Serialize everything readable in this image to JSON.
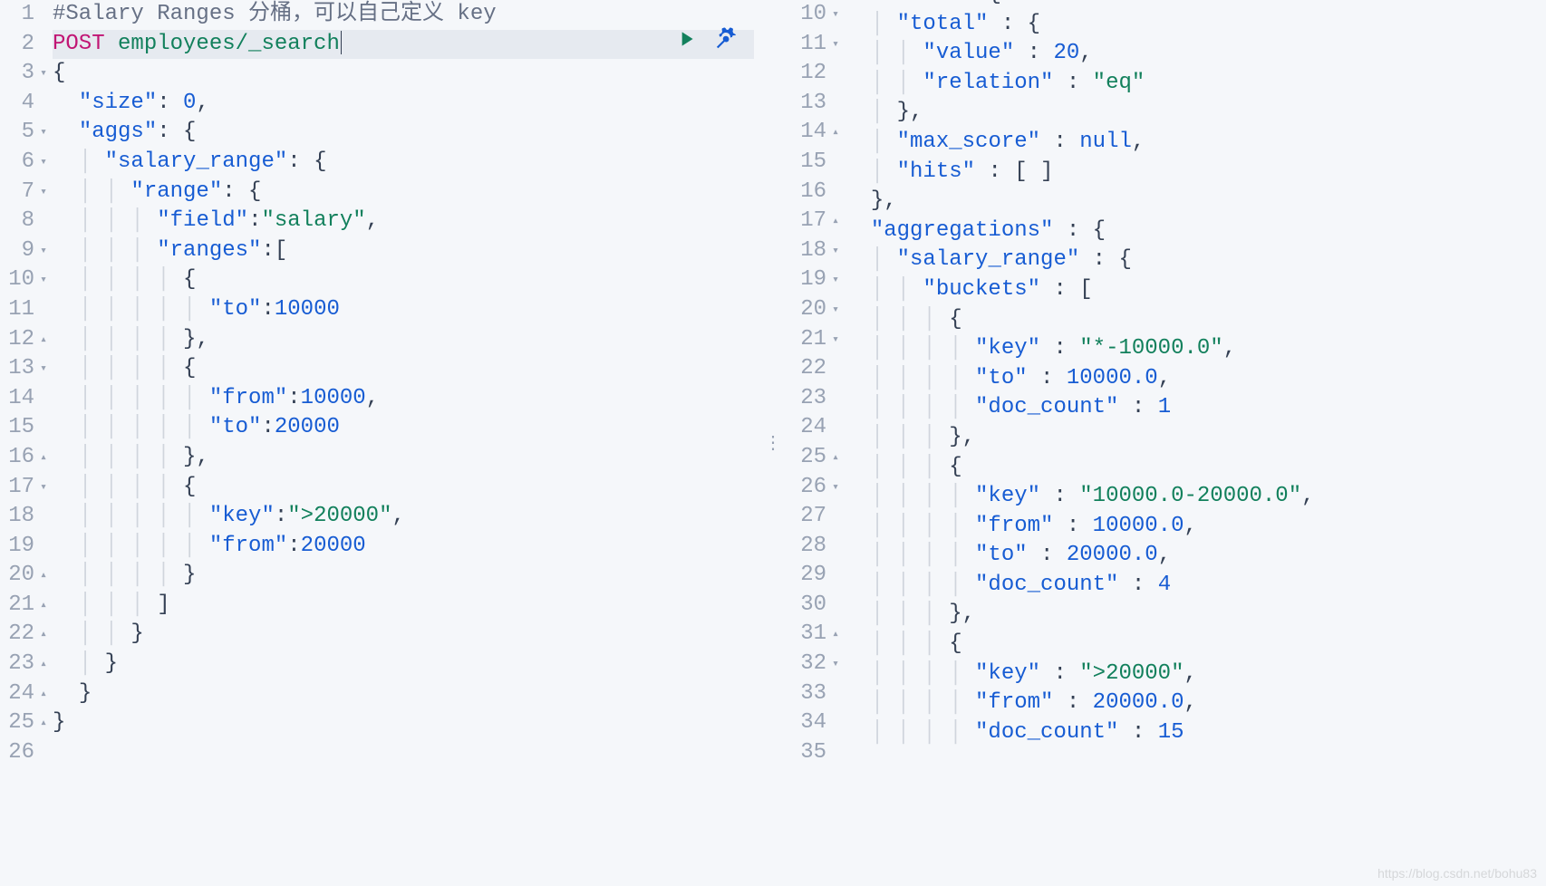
{
  "watermark": "https://blog.csdn.net/bohu83",
  "left": {
    "lines": [
      {
        "n": 1,
        "fold": "",
        "tokens": [
          [
            "comment",
            "#Salary Ranges 分桶，可以自己定义 key"
          ]
        ]
      },
      {
        "n": 2,
        "fold": "",
        "active": true,
        "tokens": [
          [
            "method",
            "POST"
          ],
          [
            "punc",
            " "
          ],
          [
            "path",
            "employees/_search"
          ]
        ],
        "cursor": true,
        "runIcons": true
      },
      {
        "n": 3,
        "fold": "▾",
        "tokens": [
          [
            "punc",
            "{"
          ]
        ]
      },
      {
        "n": 4,
        "fold": "",
        "tokens": [
          [
            "punc",
            "  "
          ],
          [
            "key",
            "\"size\""
          ],
          [
            "punc",
            ": "
          ],
          [
            "num",
            "0"
          ],
          [
            "punc",
            ","
          ]
        ]
      },
      {
        "n": 5,
        "fold": "▾",
        "tokens": [
          [
            "punc",
            "  "
          ],
          [
            "key",
            "\"aggs\""
          ],
          [
            "punc",
            ": {"
          ]
        ]
      },
      {
        "n": 6,
        "fold": "▾",
        "tokens": [
          [
            "punc",
            "  "
          ],
          [
            "guide",
            "| "
          ],
          [
            "key",
            "\"salary_range\""
          ],
          [
            "punc",
            ": {"
          ]
        ]
      },
      {
        "n": 7,
        "fold": "▾",
        "tokens": [
          [
            "punc",
            "  "
          ],
          [
            "guide",
            "| | "
          ],
          [
            "key",
            "\"range\""
          ],
          [
            "punc",
            ": {"
          ]
        ]
      },
      {
        "n": 8,
        "fold": "",
        "tokens": [
          [
            "punc",
            "  "
          ],
          [
            "guide",
            "| | | "
          ],
          [
            "key",
            "\"field\""
          ],
          [
            "punc",
            ":"
          ],
          [
            "str",
            "\"salary\""
          ],
          [
            "punc",
            ","
          ]
        ]
      },
      {
        "n": 9,
        "fold": "▾",
        "tokens": [
          [
            "punc",
            "  "
          ],
          [
            "guide",
            "| | | "
          ],
          [
            "key",
            "\"ranges\""
          ],
          [
            "punc",
            ":["
          ]
        ]
      },
      {
        "n": 10,
        "fold": "▾",
        "tokens": [
          [
            "punc",
            "  "
          ],
          [
            "guide",
            "| | | | "
          ],
          [
            "punc",
            "{"
          ]
        ]
      },
      {
        "n": 11,
        "fold": "",
        "tokens": [
          [
            "punc",
            "  "
          ],
          [
            "guide",
            "| | | | | "
          ],
          [
            "key",
            "\"to\""
          ],
          [
            "punc",
            ":"
          ],
          [
            "num",
            "10000"
          ]
        ]
      },
      {
        "n": 12,
        "fold": "▴",
        "tokens": [
          [
            "punc",
            "  "
          ],
          [
            "guide",
            "| | | | "
          ],
          [
            "punc",
            "},"
          ]
        ]
      },
      {
        "n": 13,
        "fold": "▾",
        "tokens": [
          [
            "punc",
            "  "
          ],
          [
            "guide",
            "| | | | "
          ],
          [
            "punc",
            "{"
          ]
        ]
      },
      {
        "n": 14,
        "fold": "",
        "tokens": [
          [
            "punc",
            "  "
          ],
          [
            "guide",
            "| | | | | "
          ],
          [
            "key",
            "\"from\""
          ],
          [
            "punc",
            ":"
          ],
          [
            "num",
            "10000"
          ],
          [
            "punc",
            ","
          ]
        ]
      },
      {
        "n": 15,
        "fold": "",
        "tokens": [
          [
            "punc",
            "  "
          ],
          [
            "guide",
            "| | | | | "
          ],
          [
            "key",
            "\"to\""
          ],
          [
            "punc",
            ":"
          ],
          [
            "num",
            "20000"
          ]
        ]
      },
      {
        "n": 16,
        "fold": "▴",
        "tokens": [
          [
            "punc",
            "  "
          ],
          [
            "guide",
            "| | | | "
          ],
          [
            "punc",
            "},"
          ]
        ]
      },
      {
        "n": 17,
        "fold": "▾",
        "tokens": [
          [
            "punc",
            "  "
          ],
          [
            "guide",
            "| | | | "
          ],
          [
            "punc",
            "{"
          ]
        ]
      },
      {
        "n": 18,
        "fold": "",
        "tokens": [
          [
            "punc",
            "  "
          ],
          [
            "guide",
            "| | | | | "
          ],
          [
            "key",
            "\"key\""
          ],
          [
            "punc",
            ":"
          ],
          [
            "str",
            "\">20000\""
          ],
          [
            "punc",
            ","
          ]
        ]
      },
      {
        "n": 19,
        "fold": "",
        "tokens": [
          [
            "punc",
            "  "
          ],
          [
            "guide",
            "| | | | | "
          ],
          [
            "key",
            "\"from\""
          ],
          [
            "punc",
            ":"
          ],
          [
            "num",
            "20000"
          ]
        ]
      },
      {
        "n": 20,
        "fold": "▴",
        "tokens": [
          [
            "punc",
            "  "
          ],
          [
            "guide",
            "| | | | "
          ],
          [
            "punc",
            "}"
          ]
        ]
      },
      {
        "n": 21,
        "fold": "▴",
        "tokens": [
          [
            "punc",
            "  "
          ],
          [
            "guide",
            "| | | "
          ],
          [
            "punc",
            "]"
          ]
        ]
      },
      {
        "n": 22,
        "fold": "▴",
        "tokens": [
          [
            "punc",
            "  "
          ],
          [
            "guide",
            "| | "
          ],
          [
            "punc",
            "}"
          ]
        ]
      },
      {
        "n": 23,
        "fold": "▴",
        "tokens": [
          [
            "punc",
            "  "
          ],
          [
            "guide",
            "| "
          ],
          [
            "punc",
            "}"
          ]
        ]
      },
      {
        "n": 24,
        "fold": "▴",
        "tokens": [
          [
            "punc",
            "  "
          ],
          [
            "punc",
            "}"
          ]
        ]
      },
      {
        "n": 25,
        "fold": "▴",
        "tokens": [
          [
            "punc",
            "}"
          ]
        ]
      },
      {
        "n": 26,
        "fold": "",
        "tokens": []
      }
    ]
  },
  "right": {
    "lines": [
      {
        "n": 10,
        "fold": "▾",
        "tokens": [
          [
            "punc",
            "  "
          ],
          [
            "key",
            "\"hits\""
          ],
          [
            "punc",
            " : {"
          ]
        ],
        "partial": true
      },
      {
        "n": 11,
        "fold": "▾",
        "tokens": [
          [
            "punc",
            "  "
          ],
          [
            "guide",
            "| "
          ],
          [
            "key",
            "\"total\""
          ],
          [
            "punc",
            " : {"
          ]
        ]
      },
      {
        "n": 12,
        "fold": "",
        "tokens": [
          [
            "punc",
            "  "
          ],
          [
            "guide",
            "| | "
          ],
          [
            "key",
            "\"value\""
          ],
          [
            "punc",
            " : "
          ],
          [
            "num",
            "20"
          ],
          [
            "punc",
            ","
          ]
        ]
      },
      {
        "n": 13,
        "fold": "",
        "tokens": [
          [
            "punc",
            "  "
          ],
          [
            "guide",
            "| | "
          ],
          [
            "key",
            "\"relation\""
          ],
          [
            "punc",
            " : "
          ],
          [
            "str",
            "\"eq\""
          ]
        ]
      },
      {
        "n": 14,
        "fold": "▴",
        "tokens": [
          [
            "punc",
            "  "
          ],
          [
            "guide",
            "| "
          ],
          [
            "punc",
            "},"
          ]
        ]
      },
      {
        "n": 15,
        "fold": "",
        "tokens": [
          [
            "punc",
            "  "
          ],
          [
            "guide",
            "| "
          ],
          [
            "key",
            "\"max_score\""
          ],
          [
            "punc",
            " : "
          ],
          [
            "null",
            "null"
          ],
          [
            "punc",
            ","
          ]
        ]
      },
      {
        "n": 16,
        "fold": "",
        "tokens": [
          [
            "punc",
            "  "
          ],
          [
            "guide",
            "| "
          ],
          [
            "key",
            "\"hits\""
          ],
          [
            "punc",
            " : [ ]"
          ]
        ]
      },
      {
        "n": 17,
        "fold": "▴",
        "tokens": [
          [
            "punc",
            "  "
          ],
          [
            "punc",
            "},"
          ]
        ]
      },
      {
        "n": 18,
        "fold": "▾",
        "tokens": [
          [
            "punc",
            "  "
          ],
          [
            "key",
            "\"aggregations\""
          ],
          [
            "punc",
            " : {"
          ]
        ]
      },
      {
        "n": 19,
        "fold": "▾",
        "tokens": [
          [
            "punc",
            "  "
          ],
          [
            "guide",
            "| "
          ],
          [
            "key",
            "\"salary_range\""
          ],
          [
            "punc",
            " : {"
          ]
        ]
      },
      {
        "n": 20,
        "fold": "▾",
        "tokens": [
          [
            "punc",
            "  "
          ],
          [
            "guide",
            "| | "
          ],
          [
            "key",
            "\"buckets\""
          ],
          [
            "punc",
            " : ["
          ]
        ]
      },
      {
        "n": 21,
        "fold": "▾",
        "tokens": [
          [
            "punc",
            "  "
          ],
          [
            "guide",
            "| | | "
          ],
          [
            "punc",
            "{"
          ]
        ]
      },
      {
        "n": 22,
        "fold": "",
        "tokens": [
          [
            "punc",
            "  "
          ],
          [
            "guide",
            "| | | | "
          ],
          [
            "key",
            "\"key\""
          ],
          [
            "punc",
            " : "
          ],
          [
            "str",
            "\"*-10000.0\""
          ],
          [
            "punc",
            ","
          ]
        ]
      },
      {
        "n": 23,
        "fold": "",
        "tokens": [
          [
            "punc",
            "  "
          ],
          [
            "guide",
            "| | | | "
          ],
          [
            "key",
            "\"to\""
          ],
          [
            "punc",
            " : "
          ],
          [
            "num",
            "10000.0"
          ],
          [
            "punc",
            ","
          ]
        ]
      },
      {
        "n": 24,
        "fold": "",
        "tokens": [
          [
            "punc",
            "  "
          ],
          [
            "guide",
            "| | | | "
          ],
          [
            "key",
            "\"doc_count\""
          ],
          [
            "punc",
            " : "
          ],
          [
            "num",
            "1"
          ]
        ]
      },
      {
        "n": 25,
        "fold": "▴",
        "tokens": [
          [
            "punc",
            "  "
          ],
          [
            "guide",
            "| | | "
          ],
          [
            "punc",
            "},"
          ]
        ]
      },
      {
        "n": 26,
        "fold": "▾",
        "tokens": [
          [
            "punc",
            "  "
          ],
          [
            "guide",
            "| | | "
          ],
          [
            "punc",
            "{"
          ]
        ]
      },
      {
        "n": 27,
        "fold": "",
        "tokens": [
          [
            "punc",
            "  "
          ],
          [
            "guide",
            "| | | | "
          ],
          [
            "key",
            "\"key\""
          ],
          [
            "punc",
            " : "
          ],
          [
            "str",
            "\"10000.0-20000.0\""
          ],
          [
            "punc",
            ","
          ]
        ]
      },
      {
        "n": 28,
        "fold": "",
        "tokens": [
          [
            "punc",
            "  "
          ],
          [
            "guide",
            "| | | | "
          ],
          [
            "key",
            "\"from\""
          ],
          [
            "punc",
            " : "
          ],
          [
            "num",
            "10000.0"
          ],
          [
            "punc",
            ","
          ]
        ]
      },
      {
        "n": 29,
        "fold": "",
        "tokens": [
          [
            "punc",
            "  "
          ],
          [
            "guide",
            "| | | | "
          ],
          [
            "key",
            "\"to\""
          ],
          [
            "punc",
            " : "
          ],
          [
            "num",
            "20000.0"
          ],
          [
            "punc",
            ","
          ]
        ]
      },
      {
        "n": 30,
        "fold": "",
        "tokens": [
          [
            "punc",
            "  "
          ],
          [
            "guide",
            "| | | | "
          ],
          [
            "key",
            "\"doc_count\""
          ],
          [
            "punc",
            " : "
          ],
          [
            "num",
            "4"
          ]
        ]
      },
      {
        "n": 31,
        "fold": "▴",
        "tokens": [
          [
            "punc",
            "  "
          ],
          [
            "guide",
            "| | | "
          ],
          [
            "punc",
            "},"
          ]
        ]
      },
      {
        "n": 32,
        "fold": "▾",
        "tokens": [
          [
            "punc",
            "  "
          ],
          [
            "guide",
            "| | | "
          ],
          [
            "punc",
            "{"
          ]
        ]
      },
      {
        "n": 33,
        "fold": "",
        "tokens": [
          [
            "punc",
            "  "
          ],
          [
            "guide",
            "| | | | "
          ],
          [
            "key",
            "\"key\""
          ],
          [
            "punc",
            " : "
          ],
          [
            "str",
            "\">20000\""
          ],
          [
            "punc",
            ","
          ]
        ]
      },
      {
        "n": 34,
        "fold": "",
        "tokens": [
          [
            "punc",
            "  "
          ],
          [
            "guide",
            "| | | | "
          ],
          [
            "key",
            "\"from\""
          ],
          [
            "punc",
            " : "
          ],
          [
            "num",
            "20000.0"
          ],
          [
            "punc",
            ","
          ]
        ]
      },
      {
        "n": 35,
        "fold": "",
        "tokens": [
          [
            "punc",
            "  "
          ],
          [
            "guide",
            "| | | | "
          ],
          [
            "key",
            "\"doc_count\""
          ],
          [
            "punc",
            " : "
          ],
          [
            "num",
            "15"
          ]
        ]
      }
    ]
  }
}
